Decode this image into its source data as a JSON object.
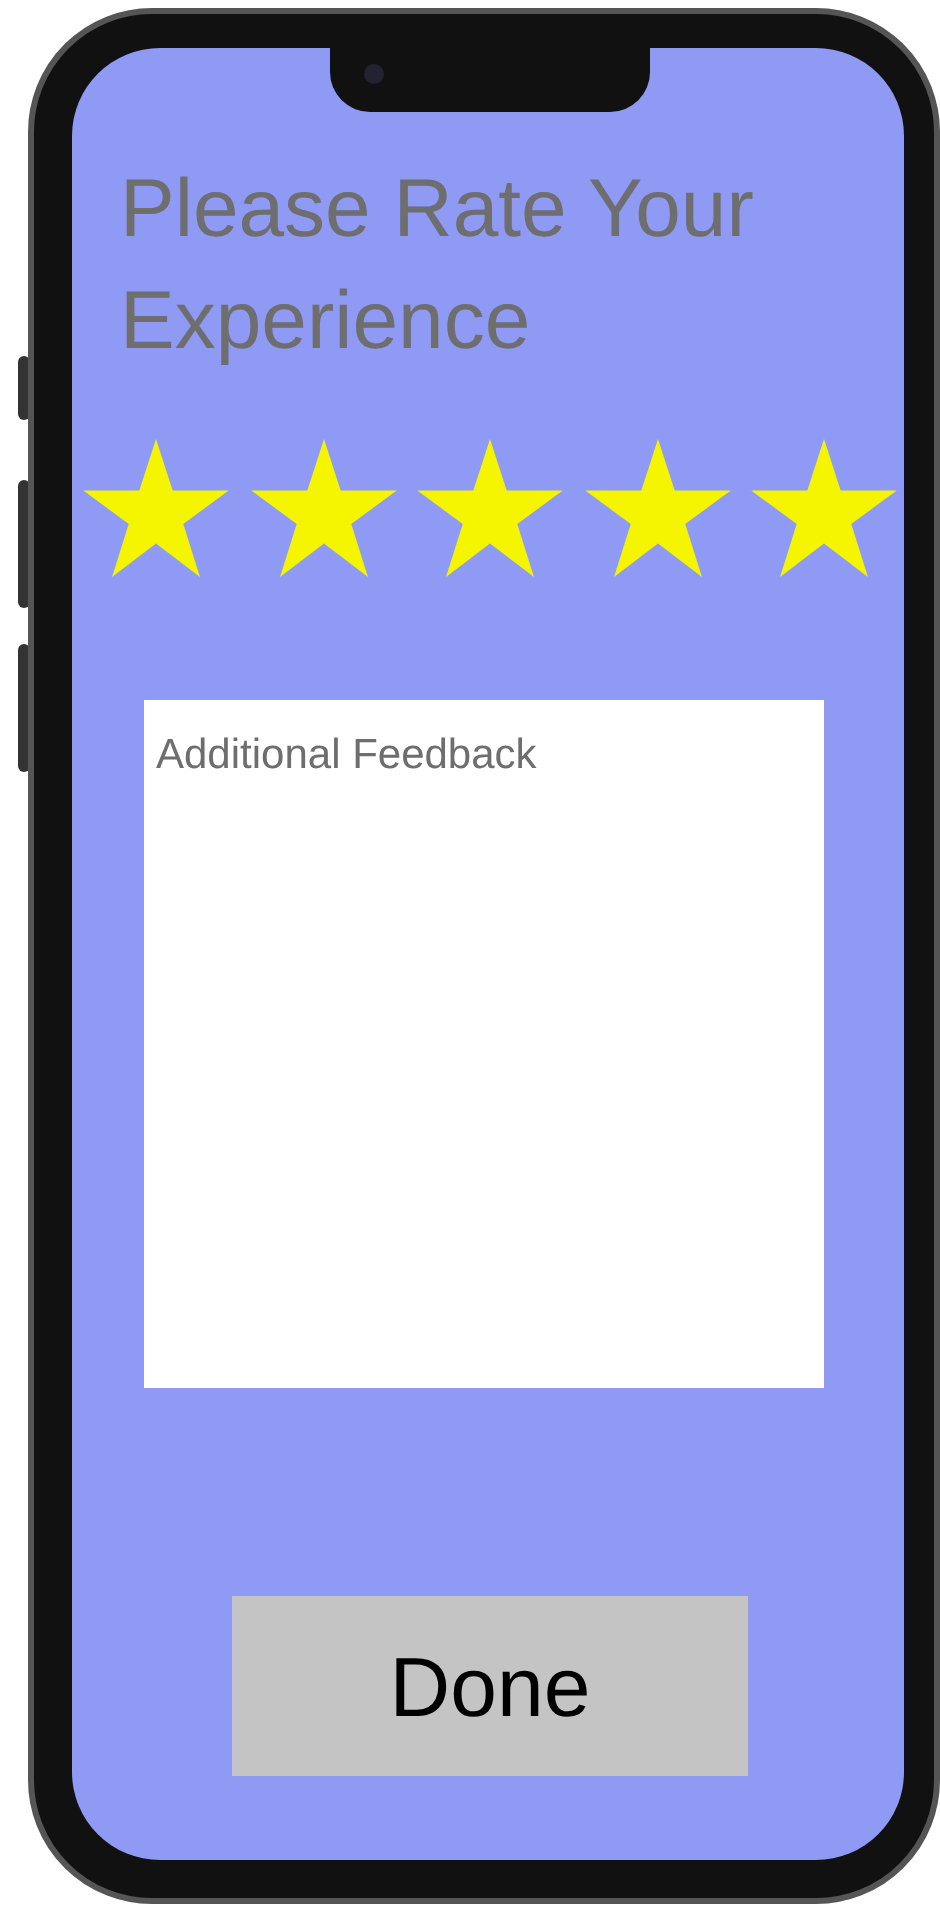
{
  "title": "Please Rate Your Experience",
  "rating": {
    "stars": 5
  },
  "feedback": {
    "placeholder": "Additional Feedback"
  },
  "done_button": {
    "label": "Done"
  }
}
